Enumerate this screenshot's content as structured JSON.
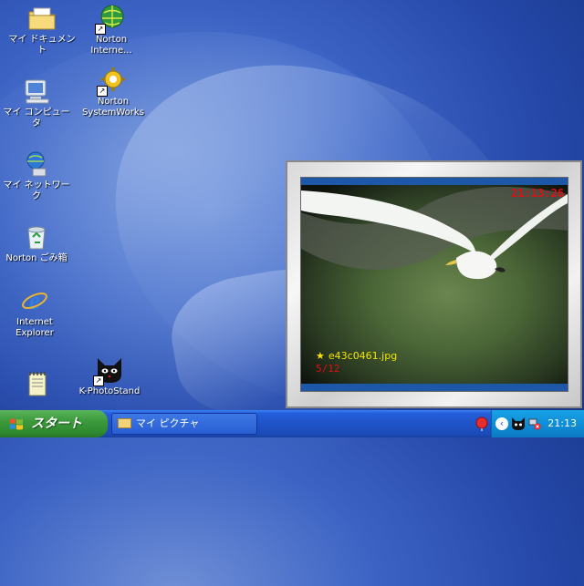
{
  "desktop": {
    "icons": [
      {
        "id": "my-documents",
        "label": "マイ ドキュメント",
        "icon": "folder-documents-icon",
        "shortcut": false
      },
      {
        "id": "norton-internet",
        "label": "Norton\nInterne...",
        "icon": "globe-icon",
        "shortcut": true
      },
      {
        "id": "my-computer",
        "label": "マイ コンピュータ",
        "icon": "computer-icon",
        "shortcut": false
      },
      {
        "id": "norton-systemworks",
        "label": "Norton\nSystemWorks",
        "icon": "gear-icon",
        "shortcut": true
      },
      {
        "id": "my-network",
        "label": "マイ ネットワーク",
        "icon": "network-icon",
        "shortcut": false
      },
      {
        "id": "norton-recycle",
        "label": "Norton ごみ箱",
        "icon": "recycle-bin-icon",
        "shortcut": false
      },
      {
        "id": "internet-explorer",
        "label": "Internet\nExplorer",
        "icon": "internet-explorer-icon",
        "shortcut": false
      },
      {
        "id": "k-photostand",
        "label": "K-PhotoStand",
        "icon": "black-cat-icon",
        "shortcut": true
      },
      {
        "id": "notepad",
        "label": "",
        "icon": "notepad-icon",
        "shortcut": false
      }
    ]
  },
  "viewer": {
    "clock": "21:13:26",
    "filename": "e43c0461.jpg",
    "counter": "5/12"
  },
  "taskbar": {
    "start_label": "スタート",
    "active_task": "マイ ピクチャ",
    "clock": "21:13"
  }
}
